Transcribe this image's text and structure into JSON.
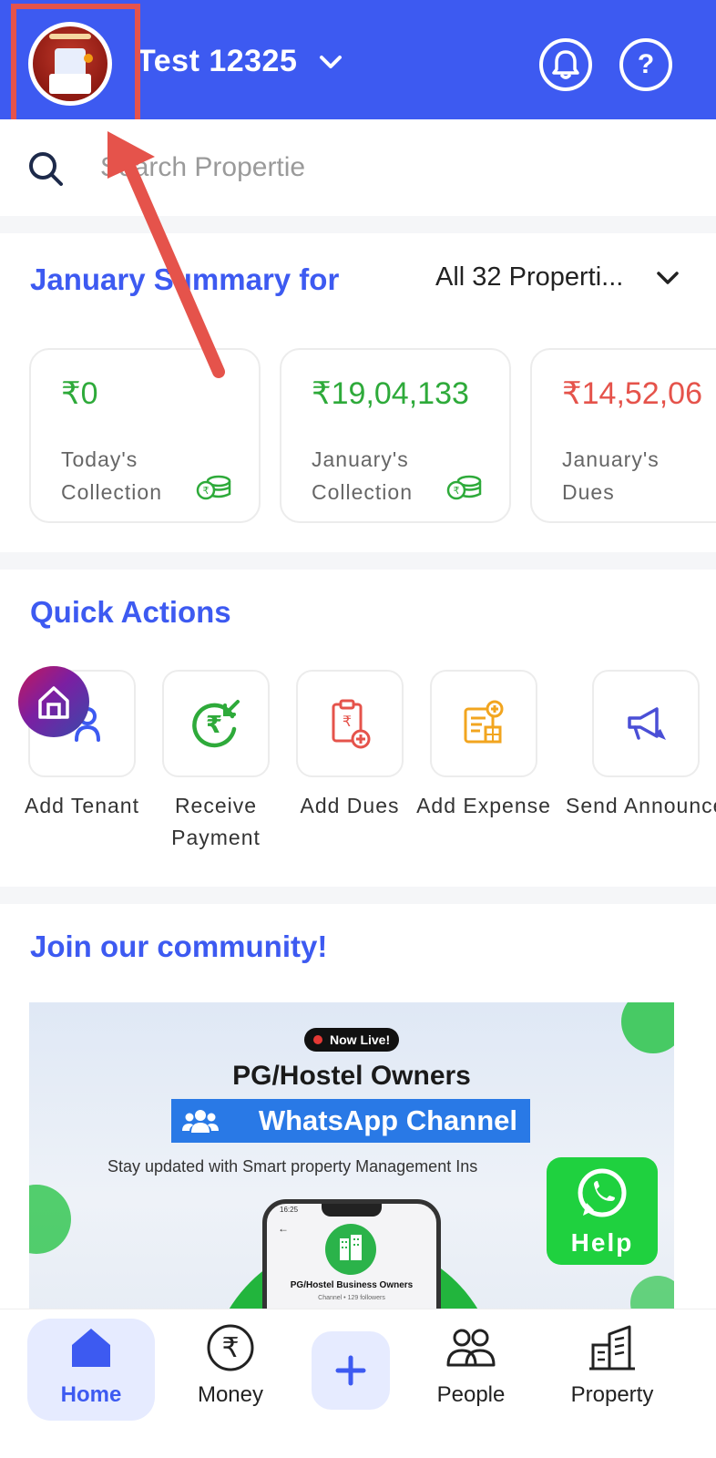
{
  "header": {
    "account_name": "Test 12325",
    "colors": {
      "header_bg": "#3d5af1",
      "highlight": "#e5534b"
    },
    "icons": [
      "avatar",
      "chevron-down-icon",
      "bell-icon",
      "help-icon"
    ],
    "help_glyph": "?"
  },
  "search": {
    "placeholder": "Search Propertie"
  },
  "summary": {
    "title": "January Summary for",
    "property_filter": "All 32 Properti...",
    "cards": [
      {
        "amount": "₹0",
        "label": "Today's Collection",
        "color": "#2eaa3a"
      },
      {
        "amount": "₹19,04,133",
        "label": "January's Collection",
        "color": "#2eaa3a"
      },
      {
        "amount": "₹14,52,06",
        "label": "January's Dues",
        "color": "#e5534b"
      }
    ]
  },
  "quick_actions": {
    "title": "Quick Actions",
    "items": [
      {
        "label": "Add Tenant",
        "icon": "add-tenant-icon"
      },
      {
        "label": "Receive Payment",
        "icon": "receive-payment-icon"
      },
      {
        "label": "Add Dues",
        "icon": "add-dues-icon"
      },
      {
        "label": "Add Expense",
        "icon": "add-expense-icon"
      },
      {
        "label": "Send Announceme",
        "icon": "megaphone-icon"
      }
    ]
  },
  "community": {
    "title": "Join our community!",
    "banner": {
      "badge": "Now Live!",
      "heading": "PG/Hostel Owners",
      "channel": "WhatsApp Channel",
      "subtext": "Stay updated with Smart property Management Ins",
      "phone_title": "PG/Hostel Business Owners",
      "phone_sub": "Channel • 129 followers",
      "phone_time": "16:25"
    }
  },
  "help_button": {
    "label": "Help"
  },
  "bottom_nav": {
    "items": [
      {
        "label": "Home",
        "active": true
      },
      {
        "label": "Money",
        "active": false
      },
      {
        "label": "People",
        "active": false
      },
      {
        "label": "Property",
        "active": false
      }
    ]
  }
}
